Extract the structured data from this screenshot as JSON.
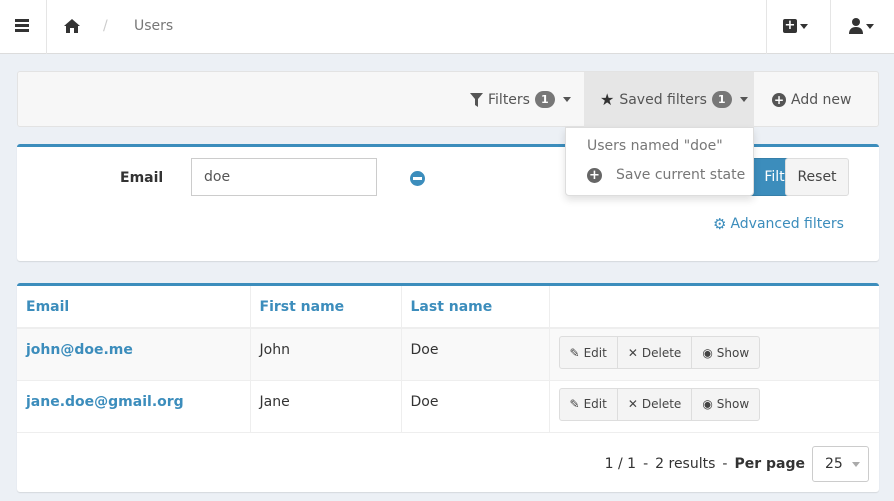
{
  "topbar": {
    "breadcrumb_sep": "/",
    "current": "Users"
  },
  "toolbar": {
    "filters_label": "Filters",
    "filters_count": "1",
    "saved_label": "Saved filters",
    "saved_count": "1",
    "add_new": "Add new"
  },
  "saved_dropdown": {
    "items": [
      "Users named \"doe\""
    ],
    "save_current": "Save current state"
  },
  "filter": {
    "label": "Email",
    "value": "doe",
    "filter_btn": "Filter",
    "reset_btn": "Reset",
    "advanced": "Advanced filters"
  },
  "table": {
    "columns": [
      "Email",
      "First name",
      "Last name"
    ],
    "rows": [
      {
        "email": "john@doe.me",
        "first": "John",
        "last": "Doe"
      },
      {
        "email": "jane.doe@gmail.org",
        "first": "Jane",
        "last": "Doe"
      }
    ],
    "actions": {
      "edit": "Edit",
      "delete": "Delete",
      "show": "Show"
    }
  },
  "pager": {
    "pages": "1 / 1",
    "sep": "-",
    "results": "2 results",
    "per_page_label": "Per page",
    "per_page": "25"
  },
  "colors": {
    "accent": "#3c8dbc",
    "background": "#ecf0f5"
  }
}
